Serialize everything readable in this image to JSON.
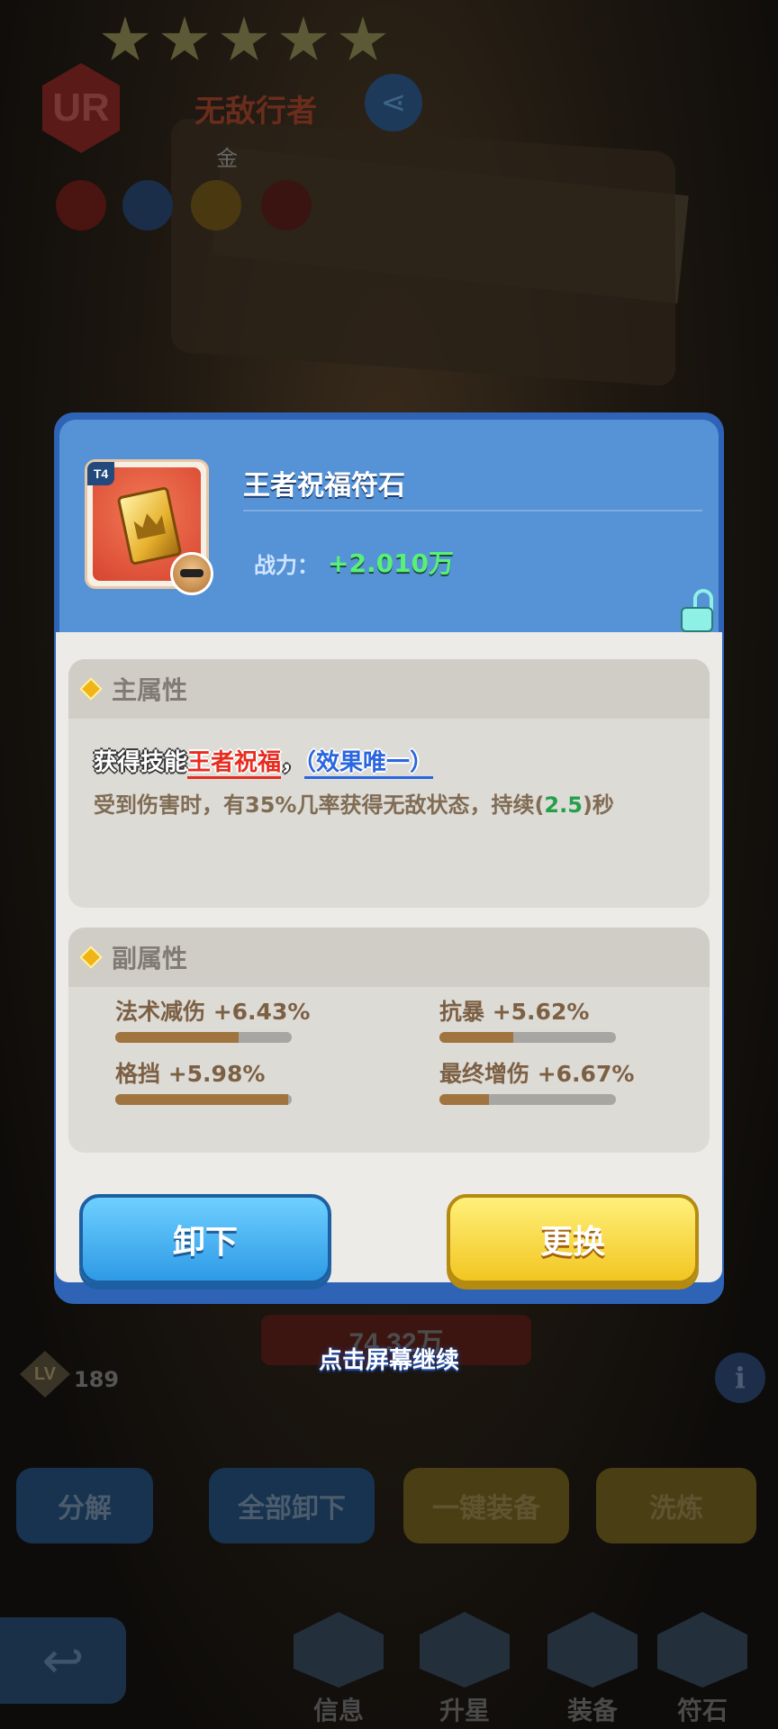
{
  "background": {
    "hero_rarity": "UR",
    "hero_name": "无敌行者",
    "hero_rank": "金",
    "level_badge": "LV",
    "level": "189",
    "power": "74.32万",
    "actions": [
      "分解",
      "全部卸下",
      "一键装备",
      "洗炼"
    ],
    "nav": [
      "信息",
      "升星",
      "装备",
      "符石"
    ]
  },
  "modal": {
    "tier": "T4",
    "item_name": "王者祝福符石",
    "power_label": "战力：",
    "power_value": "+2.010万",
    "main_attr": {
      "title": "主属性",
      "skill_prefix": "获得技能",
      "skill_name": "王者祝福",
      "skill_sep": "，",
      "skill_unique": "（效果唯一）",
      "desc_before": "受到伤害时，有35%几率获得无敌状态，持续(",
      "desc_num": "2.5",
      "desc_after": ")秒"
    },
    "sub_attr": {
      "title": "副属性",
      "stats": [
        {
          "text": "法术减伤 +6.43%",
          "level": 0.7
        },
        {
          "text": "抗暴 +5.62%",
          "level": 0.42
        },
        {
          "text": "格挡 +5.98%",
          "level": 0.98
        },
        {
          "text": "最终增伤 +6.67%",
          "level": 0.28
        }
      ]
    },
    "unequip_label": "卸下",
    "replace_label": "更换"
  },
  "continue_hint": "点击屏幕继续",
  "colors": {
    "modal_header": "#5592d6",
    "power_green": "#59f07a",
    "skill_red": "#e82c20",
    "skill_blue": "#2a66e0",
    "bar_fill": "#a0743e"
  }
}
